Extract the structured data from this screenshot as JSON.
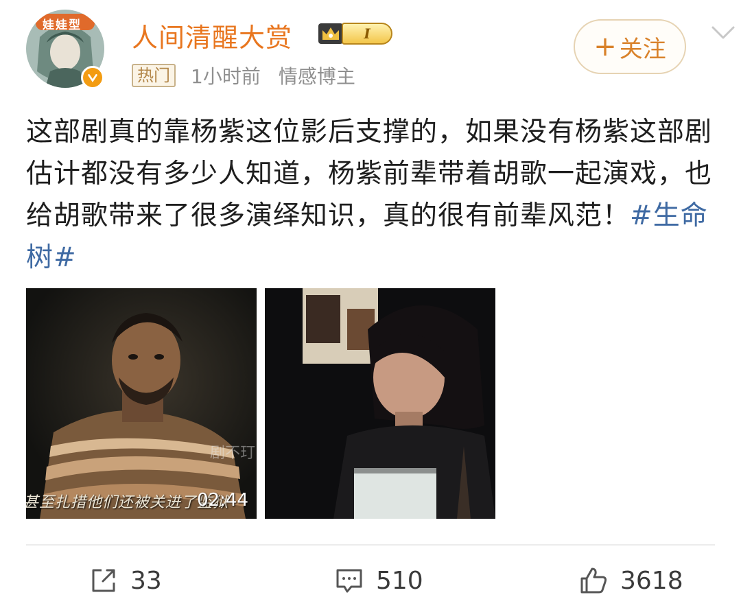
{
  "post": {
    "author": {
      "name": "人间清醒大赏",
      "avatar_label": "娃娃型",
      "level": "I",
      "hot_tag": "热门",
      "time": "1小时前",
      "role": "情感博主"
    },
    "follow_label": "关注",
    "text_main": "这部剧真的靠杨紫这位影后支撑的，如果没有杨紫这部剧估计都没有多少人知道，杨紫前辈带着胡歌一起演戏，也给胡歌带来了很多演绎知识，真的很有前辈风范！",
    "hashtag": "#生命树#",
    "media": [
      {
        "type": "video",
        "subtitle": "甚至扎措他们还被关进了监狱",
        "watermark": "剧不玎",
        "duration": "02:44"
      },
      {
        "type": "image"
      }
    ],
    "actions": {
      "repost_count": "33",
      "comment_count": "510",
      "like_count": "3618"
    }
  },
  "colors": {
    "username": "#e8761f",
    "follow": "#d9822b",
    "hashtag": "#3f6aa3",
    "meta": "#8f8f8f"
  },
  "icons": [
    "verified-badge-icon",
    "crown-icon",
    "chevron-down-icon",
    "repost-icon",
    "comment-icon",
    "like-icon",
    "plus-icon"
  ]
}
